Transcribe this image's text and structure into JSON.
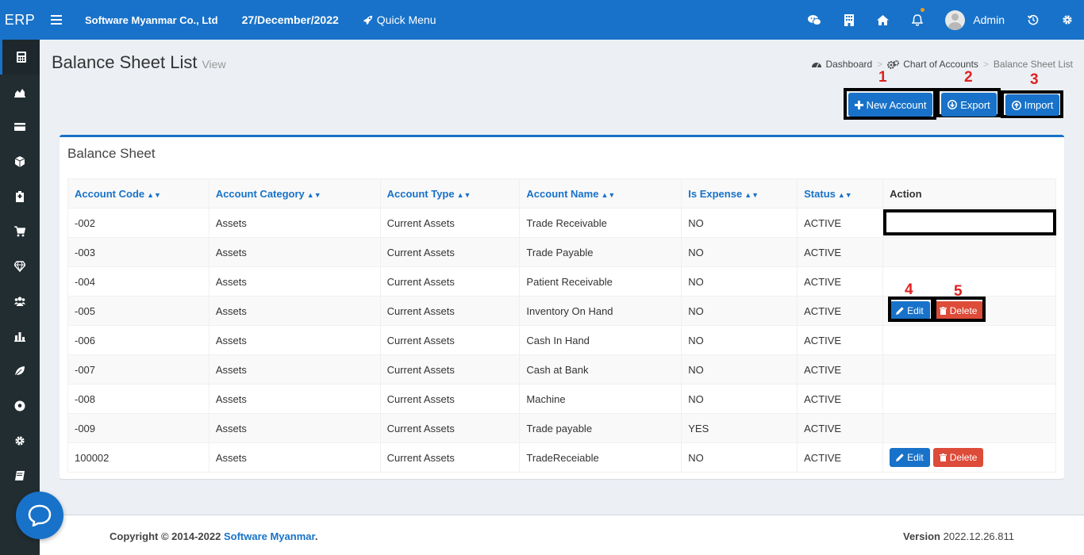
{
  "app": {
    "logo": "ERP",
    "company": "Software Myanmar Co., Ltd",
    "date": "27/December/2022",
    "quick_menu": "Quick Menu",
    "user": "Admin"
  },
  "colors": {
    "primary": "#1872c9",
    "danger": "#dd4b39",
    "sidebar": "#222d32",
    "annotation": "#e02020"
  },
  "sidebar": {
    "items": [
      "calculator-icon",
      "area-chart-icon",
      "credit-card-icon",
      "cube-icon",
      "building-icon",
      "cart-icon",
      "diamond-icon",
      "users-icon",
      "bar-chart-icon",
      "leaf-icon",
      "soccer-ball-icon",
      "settings-icon",
      "book-icon"
    ]
  },
  "page": {
    "title": "Balance Sheet List",
    "subtitle": "View"
  },
  "breadcrumb": {
    "home": "Dashboard",
    "parent": "Chart of Accounts",
    "current": "Balance Sheet List"
  },
  "actions": {
    "new_account": "New Account",
    "export": "Export",
    "import": "Import"
  },
  "annotations": {
    "n1": "1",
    "n2": "2",
    "n3": "3",
    "n4": "4",
    "n5": "5"
  },
  "table": {
    "title": "Balance Sheet",
    "headers": [
      "Account Code",
      "Account Category",
      "Account Type",
      "Account Name",
      "Is Expense",
      "Status",
      "Action"
    ],
    "rows": [
      [
        "-002",
        "Assets",
        "Current Assets",
        "Trade Receivable",
        "NO",
        "ACTIVE"
      ],
      [
        "-003",
        "Assets",
        "Current Assets",
        "Trade Payable",
        "NO",
        "ACTIVE"
      ],
      [
        "-004",
        "Assets",
        "Current Assets",
        "Patient Receivable",
        "NO",
        "ACTIVE"
      ],
      [
        "-005",
        "Assets",
        "Current Assets",
        "Inventory On Hand",
        "NO",
        "ACTIVE"
      ],
      [
        "-006",
        "Assets",
        "Current Assets",
        "Cash In Hand",
        "NO",
        "ACTIVE"
      ],
      [
        "-007",
        "Assets",
        "Current Assets",
        "Cash at Bank",
        "NO",
        "ACTIVE"
      ],
      [
        "-008",
        "Assets",
        "Current Assets",
        "Machine",
        "NO",
        "ACTIVE"
      ],
      [
        "-009",
        "Assets",
        "Current Assets",
        "Trade payable",
        "YES",
        "ACTIVE"
      ],
      [
        "100002",
        "Assets",
        "Current Assets",
        "TradeReceiable",
        "NO",
        "ACTIVE"
      ]
    ],
    "edit_label": "Edit",
    "delete_label": "Delete"
  },
  "footer": {
    "copyright": "Copyright © 2014-2022 ",
    "company_link": "Software Myanmar",
    "dot": ".",
    "version_label": "Version",
    "version": "2022.12.26.811"
  }
}
